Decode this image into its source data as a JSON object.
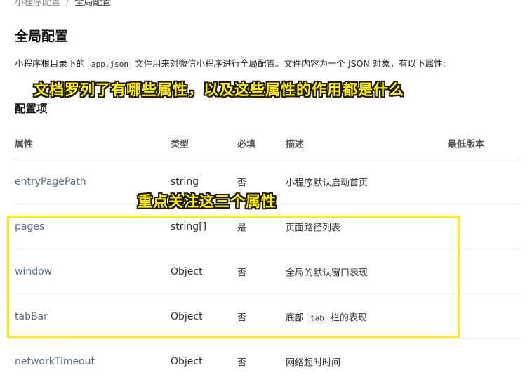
{
  "breadcrumb": {
    "parent": "小程序配置",
    "separator": "/",
    "current": "全局配置"
  },
  "page_title": "全局配置",
  "intro": {
    "before": "小程序根目录下的",
    "code": "app.json",
    "after": "文件用来对微信小程序进行全局配置。文件内容为一个 JSON 对象，有以下属性:"
  },
  "annotations": {
    "top": "文档罗列了有哪些属性，以及这些属性的作用都是什么",
    "middle": "重点关注这三个属性"
  },
  "section_title": "配置项",
  "table": {
    "headers": {
      "property": "属性",
      "type": "类型",
      "required": "必填",
      "description": "描述",
      "min_version": "最低版本"
    },
    "rows": [
      {
        "property": "entryPagePath",
        "type": "string",
        "required": "否",
        "description": "小程序默认启动首页"
      },
      {
        "property": "pages",
        "type": "string[]",
        "required": "是",
        "description": "页面路径列表"
      },
      {
        "property": "window",
        "type": "Object",
        "required": "否",
        "description": "全局的默认窗口表现"
      },
      {
        "property": "tabBar",
        "type": "Object",
        "required": "否",
        "description_before": "底部",
        "description_code": "tab",
        "description_after": "栏的表现"
      },
      {
        "property": "networkTimeout",
        "type": "Object",
        "required": "否",
        "description": "网络超时时间"
      }
    ]
  },
  "colors": {
    "link": "#576b95",
    "annotation_fill": "#ffee00",
    "highlight_border": "#ffee00"
  }
}
